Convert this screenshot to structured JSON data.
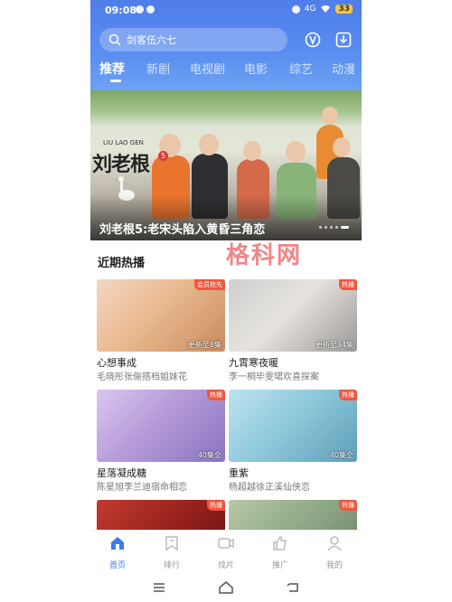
{
  "status_bar": {
    "time": "09:08",
    "signal": "4G",
    "battery": "33"
  },
  "search": {
    "placeholder": "剑客伍六七"
  },
  "tabs": [
    {
      "label": "推荐"
    },
    {
      "label": "新剧"
    },
    {
      "label": "电视剧"
    },
    {
      "label": "电影"
    },
    {
      "label": "综艺"
    },
    {
      "label": "动漫"
    }
  ],
  "banner": {
    "title_small": "LIU LAO GEN",
    "title_logo": "刘老根",
    "title_badge": "5",
    "caption": "刘老根5:老宋头陷入黄昏三角恋"
  },
  "watermark": "格科网",
  "section": {
    "title": "近期热播"
  },
  "cards": [
    {
      "title": "心想事成",
      "subtitle": "毛晓彤张俪搭档姐妹花",
      "episode": "更新至8集",
      "tag": "会员抢先"
    },
    {
      "title": "九霄寒夜暖",
      "subtitle": "李一桐毕雯珺欢喜探案",
      "episode": "更新至34集",
      "tag": "热播"
    },
    {
      "title": "星落凝成糖",
      "subtitle": "陈星旭李兰迪宿命相恋",
      "episode": "40集全",
      "tag": "热播"
    },
    {
      "title": "重紫",
      "subtitle": "杨超越徐正溪仙侠恋",
      "episode": "40集全",
      "tag": "热播"
    },
    {
      "title": "",
      "subtitle": "",
      "episode": "",
      "tag": "热播"
    },
    {
      "title": "",
      "subtitle": "",
      "episode": "",
      "tag": "热播"
    }
  ],
  "bottom_nav": [
    {
      "label": "首页",
      "icon": "home-icon"
    },
    {
      "label": "排行",
      "icon": "ranking-icon"
    },
    {
      "label": "找片",
      "icon": "camera-icon"
    },
    {
      "label": "推广",
      "icon": "thumbs-up-icon"
    },
    {
      "label": "我的",
      "icon": "user-icon"
    }
  ],
  "colors": {
    "accent": "#3b7bea",
    "header": "#5a8ef0",
    "tag": "#f0563f"
  }
}
